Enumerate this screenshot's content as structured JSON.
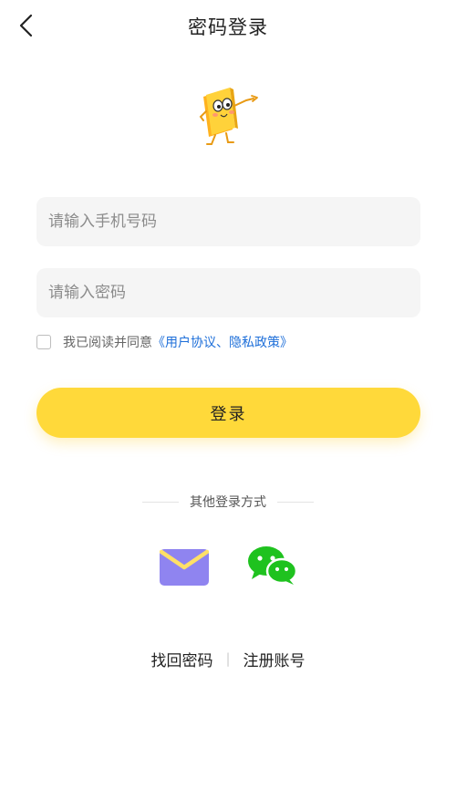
{
  "header": {
    "title": "密码登录",
    "back_icon": "chevron-left-icon"
  },
  "mascot": {
    "icon": "book-mascot"
  },
  "form": {
    "phone_placeholder": "请输入手机号码",
    "password_placeholder": "请输入密码",
    "phone_value": "",
    "password_value": ""
  },
  "agreement": {
    "checked": false,
    "prefix": "我已阅读并同意",
    "link_open": "《",
    "user_agreement": "用户协议",
    "separator": "、",
    "privacy_policy": "隐私政策",
    "link_close": "》"
  },
  "login_button": "登录",
  "other_login": {
    "label": "其他登录方式",
    "methods": [
      {
        "icon": "email-icon",
        "color": "#8f84f0"
      },
      {
        "icon": "wechat-icon",
        "color": "#1fc21f"
      }
    ]
  },
  "bottom_links": {
    "forgot_password": "找回密码",
    "separator": "|",
    "register": "注册账号"
  },
  "colors": {
    "accent": "#ffd93a",
    "link": "#1e6fd9",
    "input_bg": "#f5f5f5"
  }
}
